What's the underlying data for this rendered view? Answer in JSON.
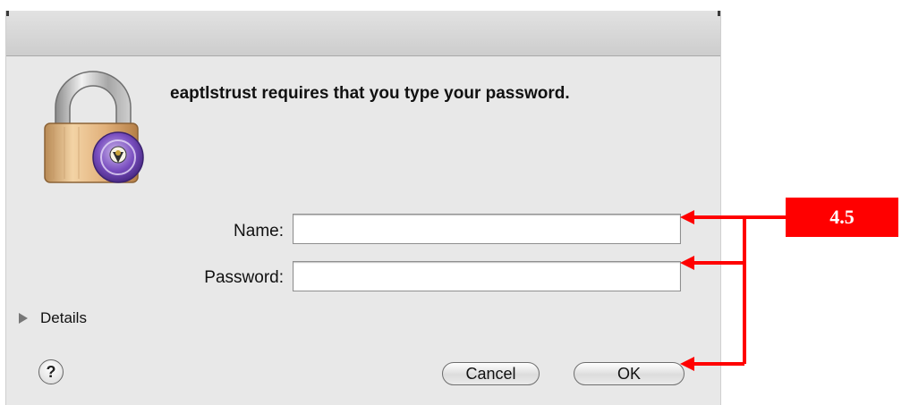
{
  "dialog": {
    "message": "eaptlstrust requires that you type your password.",
    "name_label": "Name:",
    "name_value": "",
    "password_label": "Password:",
    "password_value": "",
    "details_label": "Details",
    "help_label": "?",
    "cancel_label": "Cancel",
    "ok_label": "OK"
  },
  "annotation": {
    "label": "4.5",
    "color": "#ff0000"
  },
  "icons": {
    "lock": "lock-icon",
    "disclosure": "disclosure-triangle-icon",
    "help": "help-icon"
  }
}
